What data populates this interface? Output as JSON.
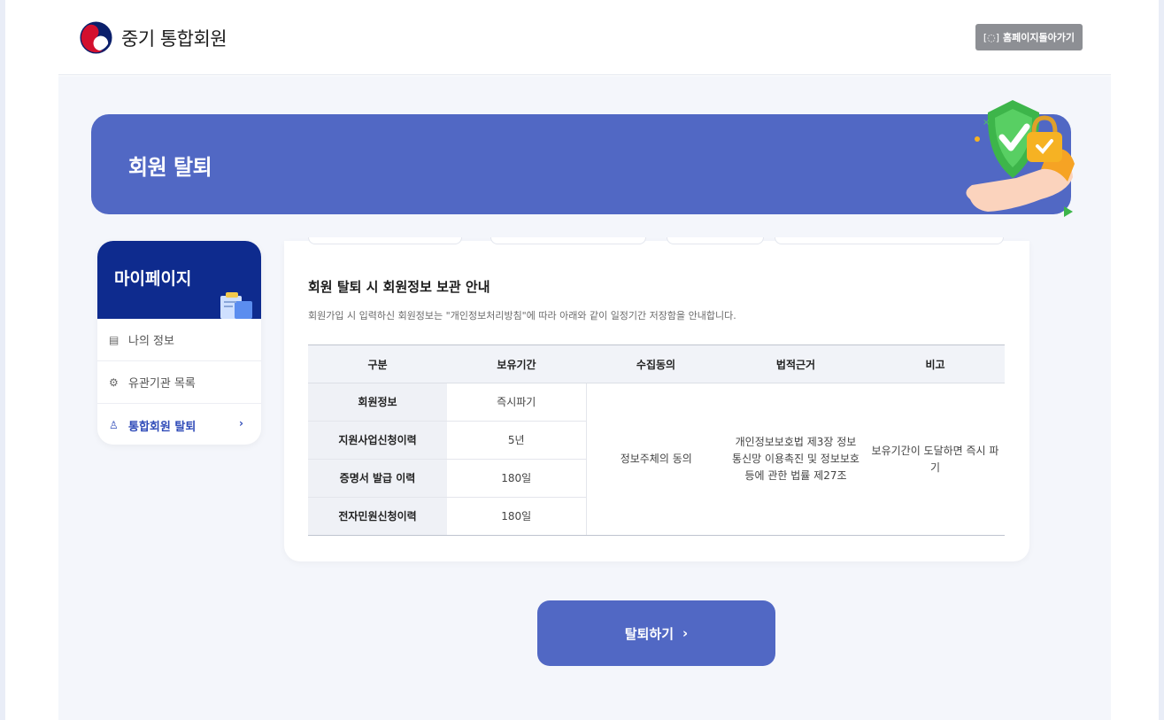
{
  "header": {
    "site_title": "중기 통합회원",
    "home_button_label": "홈페이지돌아가기",
    "home_button_icon": "home-scan-icon"
  },
  "banner": {
    "title": "회원 탈퇴",
    "illustration": "shield-lock-hand-illustration"
  },
  "sidebar": {
    "title": "마이페이지",
    "items": [
      {
        "label": "나의 정보",
        "icon": "document-icon"
      },
      {
        "label": "유관기관 목록",
        "icon": "gear-icon"
      },
      {
        "label": "통합회원 탈퇴",
        "icon": "user-remove-icon",
        "active": true
      }
    ]
  },
  "content": {
    "title": "회원 탈퇴 시 회원정보 보관 안내",
    "description": "회원가입 시 입력하신 회원정보는 \"개인정보처리방침\"에 따라 아래와 같이 일정기간 저장함을 안내합니다.",
    "table": {
      "headers": [
        "구분",
        "보유기간",
        "수집동의",
        "법적근거",
        "비고"
      ],
      "rows": [
        {
          "category": "회원정보",
          "period": "즉시파기"
        },
        {
          "category": "지원사업신청이력",
          "period": "5년"
        },
        {
          "category": "증명서 발급 이력",
          "period": "180일"
        },
        {
          "category": "전자민원신청이력",
          "period": "180일"
        }
      ],
      "consent": "정보주체의 동의",
      "legal_basis": "개인정보보호법 제3장 정보통신망 이용촉진 및 정보보호 등에 관한 법률 제27조",
      "note": "보유기간이 도달하면 즉시 파기"
    }
  },
  "actions": {
    "withdraw_label": "탈퇴하기",
    "withdraw_chevron": "›"
  },
  "colors": {
    "primary": "#5168c4",
    "sidebar_head": "#0e2b8e",
    "active_text": "#2f4bb8"
  }
}
